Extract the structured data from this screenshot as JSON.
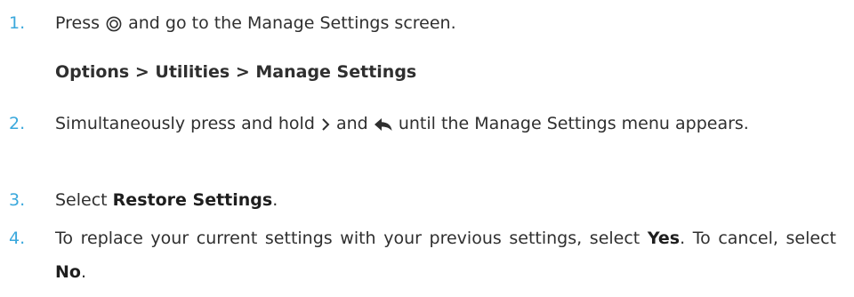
{
  "steps": [
    {
      "number": "1.",
      "before_icon": "Press",
      "icon": "ok-button-icon",
      "after_icon": "and go to the Manage Settings screen."
    },
    {
      "number": "2.",
      "part1": "Simultaneously press and hold",
      "icon1": "right-chevron-icon",
      "part2": "and",
      "icon2": "back-arrow-icon",
      "part3": "until the Manage Settings menu appears."
    },
    {
      "number": "3.",
      "before": "Select",
      "bold": "Restore Settings",
      "after": "."
    },
    {
      "number": "4.",
      "part1": "To replace your current settings with your previous settings, select",
      "bold1": "Yes",
      "part2": ". To cancel, select",
      "bold2": "No",
      "part3": "."
    }
  ],
  "path": "Options > Utilities > Manage Settings",
  "colors": {
    "number": "#3aa8dc",
    "text": "#2f2f2f"
  }
}
